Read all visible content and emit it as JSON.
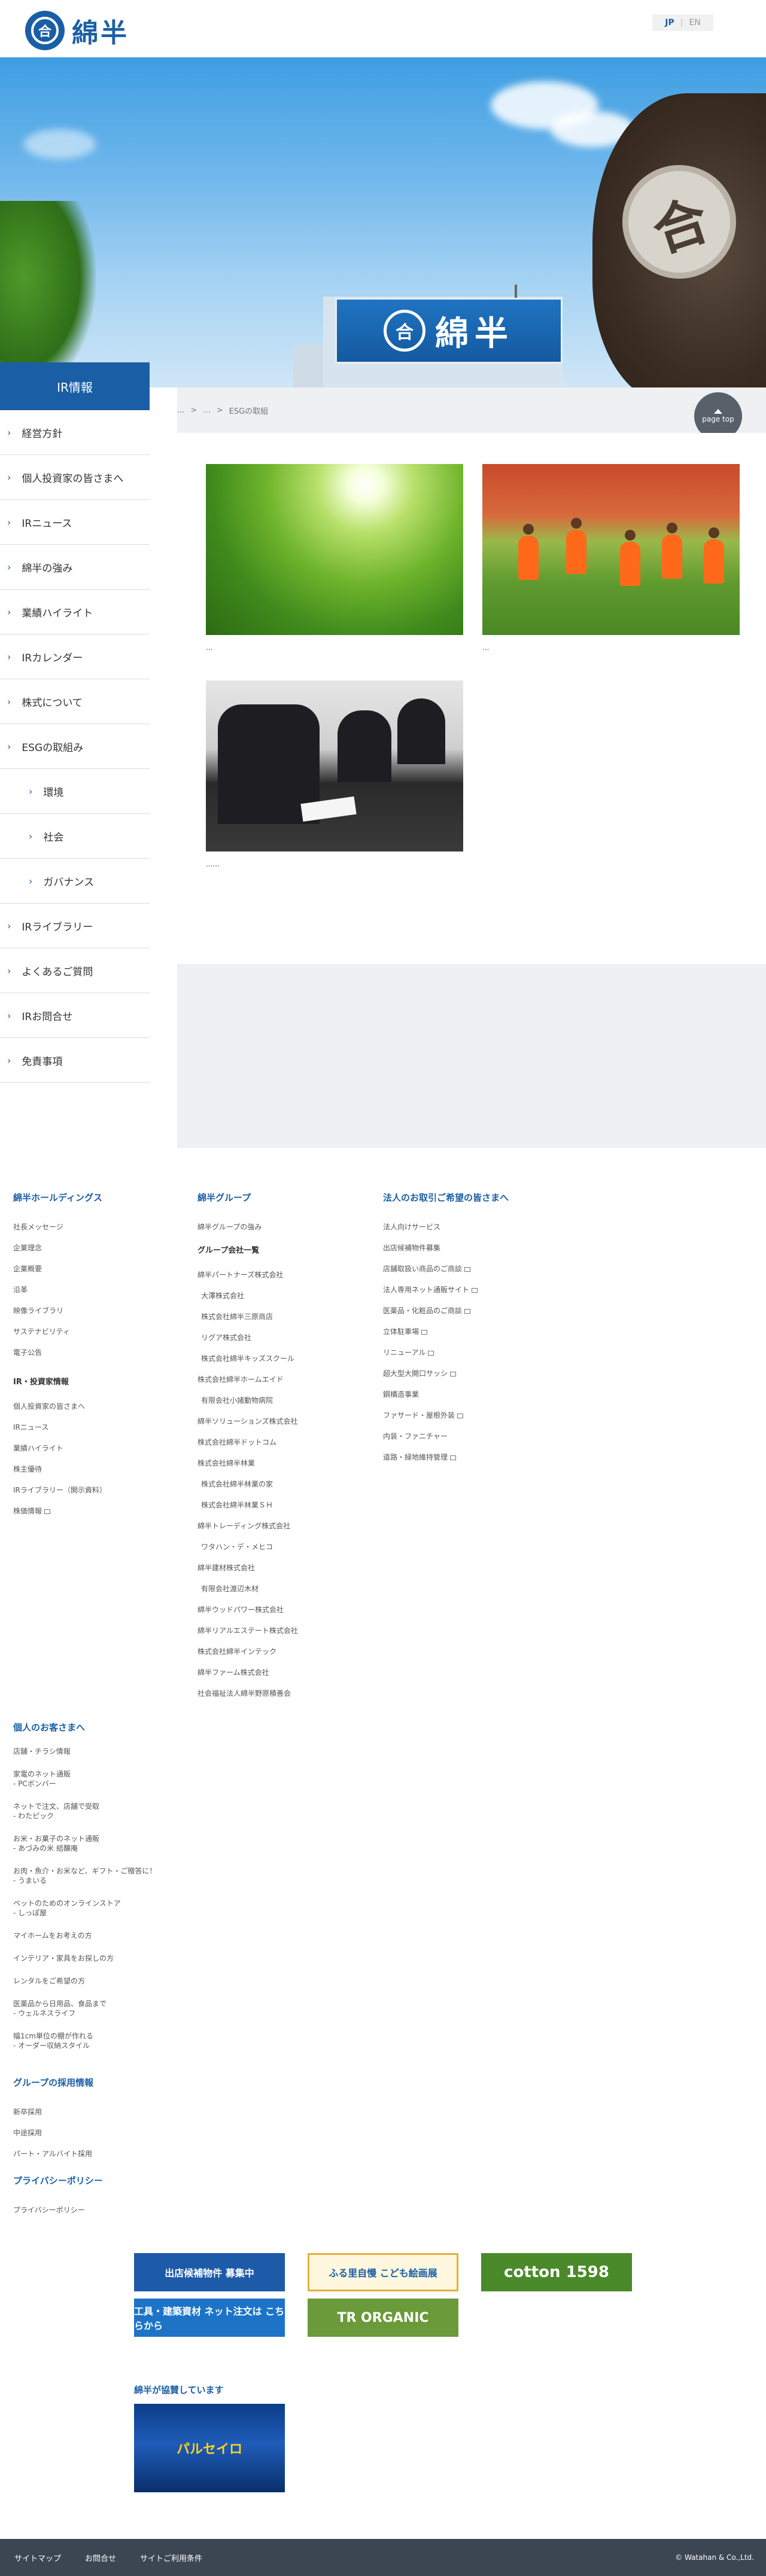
{
  "header": {
    "logo_text": "綿半",
    "logo_mark": "合",
    "lang_jp": "JP",
    "lang_en": "EN"
  },
  "hero": {
    "sign_text": "綿半",
    "sign_mark": "合",
    "stone_mark": "合"
  },
  "sidebar": {
    "title": "IR情報",
    "items": [
      {
        "label": "経営方針",
        "sub": false
      },
      {
        "label": "個人投資家の皆さまへ",
        "sub": false
      },
      {
        "label": "IRニュース",
        "sub": false
      },
      {
        "label": "綿半の強み",
        "sub": false
      },
      {
        "label": "業績ハイライト",
        "sub": false
      },
      {
        "label": "IRカレンダー",
        "sub": false
      },
      {
        "label": "株式について",
        "sub": false
      },
      {
        "label": "ESGの取組み",
        "sub": false
      },
      {
        "label": "環境",
        "sub": true
      },
      {
        "label": "社会",
        "sub": true
      },
      {
        "label": "ガバナンス",
        "sub": true
      },
      {
        "label": "IRライブラリー",
        "sub": false
      },
      {
        "label": "よくあるご質問",
        "sub": false
      },
      {
        "label": "IRお問合せ",
        "sub": false
      },
      {
        "label": "免責事項",
        "sub": false
      }
    ]
  },
  "breadcrumb": {
    "items": [
      "...",
      ">",
      "...",
      ">",
      "ESGの取組"
    ]
  },
  "page_top": "page top",
  "cards": [
    {
      "caption": "..."
    },
    {
      "caption": "..."
    },
    {
      "caption": "......"
    }
  ],
  "footer": {
    "col1": {
      "head": "綿半ホールディングス",
      "links": [
        "社長メッセージ",
        "企業理念",
        "企業概要",
        "沿革",
        "映像ライブラリ",
        "サステナビリティ",
        "電子公告"
      ],
      "sub": "IR・投資家情報",
      "ir_links": [
        "個人投資家の皆さまへ",
        "IRニュース",
        "業績ハイライト",
        "株主優待",
        "IRライブラリー（開示資料）",
        "株価情報"
      ]
    },
    "col2": {
      "head": "綿半グループ",
      "link": "綿半グループの強み",
      "sub": "グループ会社一覧",
      "links": [
        {
          "t": "綿半パートナーズ株式会社",
          "i": false
        },
        {
          "t": "大澤株式会社",
          "i": true
        },
        {
          "t": "株式会社綿半三原商店",
          "i": true
        },
        {
          "t": "リグア株式会社",
          "i": true
        },
        {
          "t": "株式会社綿半キッズスクール",
          "i": true
        },
        {
          "t": "株式会社綿半ホームエイド",
          "i": false
        },
        {
          "t": "有限会社小諸動物病院",
          "i": true
        },
        {
          "t": "綿半ソリューションズ株式会社",
          "i": false
        },
        {
          "t": "株式会社綿半ドットコム",
          "i": false
        },
        {
          "t": "株式会社綿半林業",
          "i": false
        },
        {
          "t": "株式会社綿半林業の家",
          "i": true
        },
        {
          "t": "株式会社綿半林業ＳＨ",
          "i": true
        },
        {
          "t": "綿半トレーディング株式会社",
          "i": false
        },
        {
          "t": "ワタハン・デ・メヒコ",
          "i": true
        },
        {
          "t": "綿半建材株式会社",
          "i": false
        },
        {
          "t": "有限会社渡辺木材",
          "i": true
        },
        {
          "t": "綿半ウッドパワー株式会社",
          "i": false
        },
        {
          "t": "綿半リアルエステート株式会社",
          "i": false
        },
        {
          "t": "株式会社綿半インテック",
          "i": false
        },
        {
          "t": "綿半ファーム株式会社",
          "i": false
        },
        {
          "t": "社会福祉法人綿半野原積善会",
          "i": false
        }
      ]
    },
    "col3": {
      "head": "法人のお取引ご希望の皆さまへ",
      "links": [
        {
          "t": "法人向けサービス",
          "e": false
        },
        {
          "t": "出店候補物件募集",
          "e": false
        },
        {
          "t": "店舗取扱い商品のご商談",
          "e": true
        },
        {
          "t": "法人専用ネット通販サイト",
          "e": true
        },
        {
          "t": "医薬品・化粧品のご商談",
          "e": true
        },
        {
          "t": "立体駐車場",
          "e": true
        },
        {
          "t": "リニューアル",
          "e": true
        },
        {
          "t": "超大型大開口サッシ",
          "e": true
        },
        {
          "t": "鋼構造事業",
          "e": false
        },
        {
          "t": "ファサード・屋根外装",
          "e": true
        },
        {
          "t": "内装・ファニチャー",
          "e": false
        },
        {
          "t": "道路・緑地維持管理",
          "e": true
        }
      ]
    },
    "personal": {
      "head": "個人のお客さまへ",
      "links": [
        {
          "l1": "店舗・チラシ情報",
          "l2": ""
        },
        {
          "l1": "家電のネット通販",
          "l2": "- PCボンバー"
        },
        {
          "l1": "ネットで注文、店舗で受取",
          "l2": "- わたピック"
        },
        {
          "l1": "お米・お菓子のネット通販",
          "l2": "- あづみの米 結醸庵"
        },
        {
          "l1": "お肉・魚介・お米など、ギフト・ご贈答に！",
          "l2": "- うまいる"
        },
        {
          "l1": "ペットのためのオンラインストア",
          "l2": "- しっぽ屋"
        },
        {
          "l1": "マイホームをお考えの方",
          "l2": ""
        },
        {
          "l1": "インテリア・家具をお探しの方",
          "l2": ""
        },
        {
          "l1": "レンタルをご希望の方",
          "l2": ""
        },
        {
          "l1": "医薬品から日用品、食品まで",
          "l2": "- ウェルネスライフ"
        },
        {
          "l1": "幅1cm単位の棚が作れる",
          "l2": "- オーダー収納スタイル"
        }
      ]
    },
    "recruit": {
      "head": "グループの採用情報",
      "links": [
        "新卒採用",
        "中途採用",
        "パート・アルバイト採用"
      ]
    },
    "privacy": {
      "head": "プライバシーポリシー",
      "link": "プライバシーポリシー"
    }
  },
  "banners": [
    {
      "label": "出店候補物件 募集中",
      "color": "#1d5aa8"
    },
    {
      "label": "ふる里自慢 こども絵画展",
      "color": "#f0c84a"
    },
    {
      "label": "cotton 1598",
      "color": "#4a8a2a"
    },
    {
      "label": "工具・建築資材 ネット注文は こちらから",
      "color": "#1d74c7"
    },
    {
      "label": "TR ORGANIC",
      "color": "#6a9a3a"
    }
  ],
  "partner": {
    "head": "綿半が協賛しています",
    "banner_text": "パルセイロ"
  },
  "bottom": {
    "links": [
      "サイトマップ",
      "お問合せ",
      "サイトご利用条件"
    ],
    "copyright": "© Watahan & Co.,Ltd."
  },
  "colors": {
    "brand": "#1a5fa6",
    "footer_bar": "#3c4653"
  }
}
